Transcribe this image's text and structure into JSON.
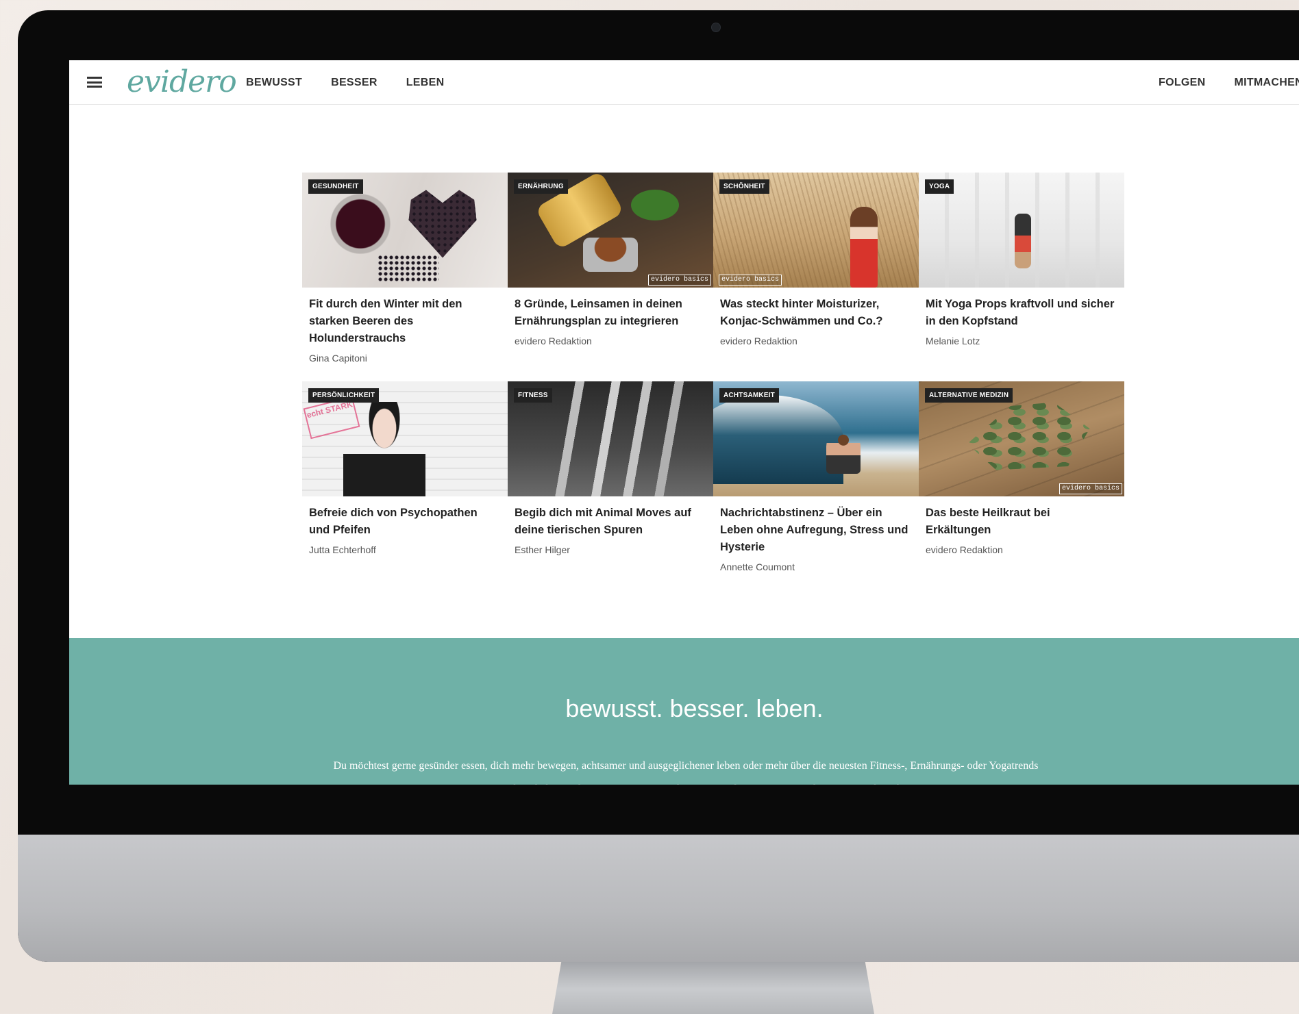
{
  "header": {
    "logo": "evidero",
    "nav_left": [
      "BEWUSST",
      "BESSER",
      "LEBEN"
    ],
    "nav_right": [
      "FOLGEN",
      "MITMACHEN"
    ]
  },
  "badge_text": "evidero basics",
  "articles": [
    {
      "category": "GESUNDHEIT",
      "title": "Fit durch den Winter mit den starken Beeren des Holunderstrauchs",
      "author": "Gina Capitoni"
    },
    {
      "category": "ERNÄHRUNG",
      "title": "8 Gründe, Leinsamen in deinen Ernährungsplan zu integrieren",
      "author": "evidero Redaktion"
    },
    {
      "category": "SCHÖNHEIT",
      "title": "Was steckt hinter Moisturizer, Konjac-Schwämmen und Co.?",
      "author": "evidero Redaktion"
    },
    {
      "category": "YOGA",
      "title": "Mit Yoga Props kraftvoll und sicher in den Kopfstand",
      "author": "Melanie Lotz"
    },
    {
      "category": "PERSÖNLICHKEIT",
      "title": "Befreie dich von Psychopathen und Pfeifen",
      "author": "Jutta Echterhoff"
    },
    {
      "category": "FITNESS",
      "title": "Begib dich mit Animal Moves auf deine tierischen Spuren",
      "author": "Esther Hilger"
    },
    {
      "category": "ACHTSAMKEIT",
      "title": "Nachrichtabstinenz – Über ein Leben ohne Aufregung, Stress und Hysterie",
      "author": "Annette Coumont"
    },
    {
      "category": "ALTERNATIVE MEDIZIN",
      "title": "Das beste Heilkraut bei Erkältungen",
      "author": "evidero Redaktion"
    }
  ],
  "stamp_text": "echt STARK",
  "banner": {
    "title": "bewusst. besser. leben.",
    "text": "Du möchtest gerne gesünder essen, dich mehr bewegen, achtsamer und ausgeglichener leben oder mehr über die neuesten Fitness-, Ernährungs- oder Yogatrends erfahren? Dann bist du bei evidero genau richtig. evidero möchte dich animieren und inspirieren, dir jeden Tag"
  },
  "colors": {
    "accent": "#6fb1a7",
    "logo": "#5fa8a0",
    "tag_bg": "#222222"
  },
  "icons": [
    "hamburger-menu-icon"
  ]
}
